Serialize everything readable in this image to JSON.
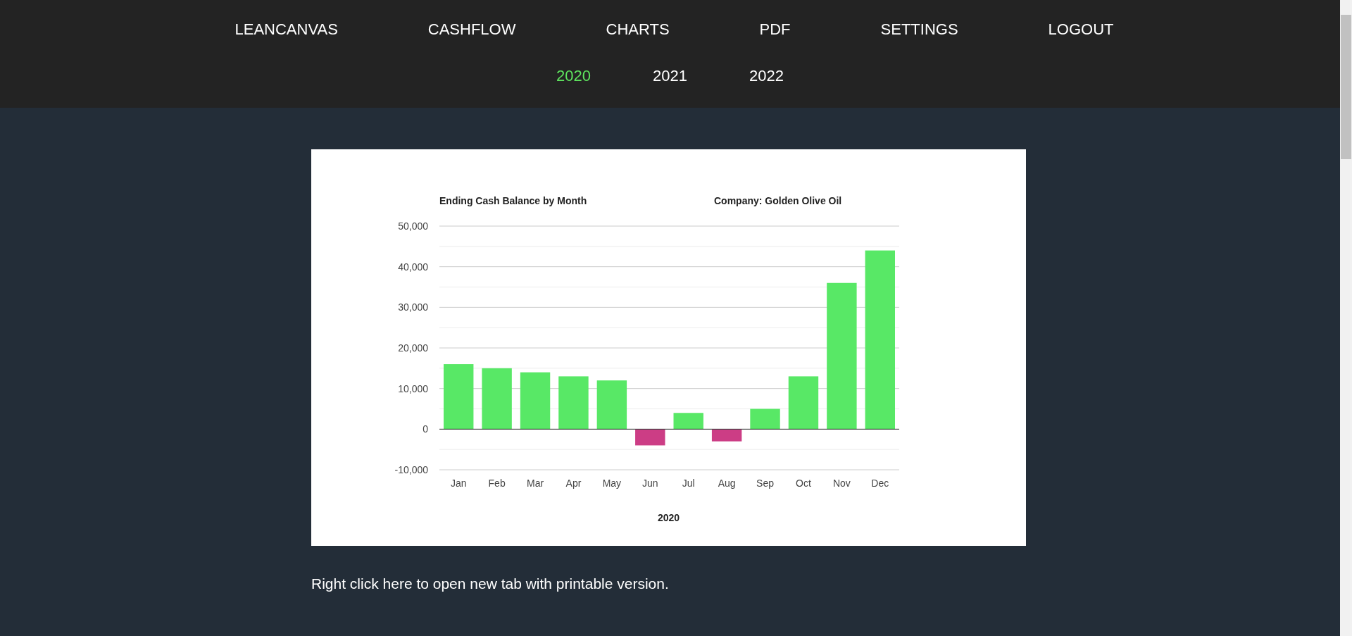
{
  "nav": {
    "items": [
      {
        "label": "LEANCANVAS"
      },
      {
        "label": "CASHFLOW"
      },
      {
        "label": "CHARTS"
      },
      {
        "label": "PDF"
      },
      {
        "label": "SETTINGS"
      },
      {
        "label": "LOGOUT"
      }
    ]
  },
  "years": [
    {
      "label": "2020",
      "selected": true
    },
    {
      "label": "2021",
      "selected": false
    },
    {
      "label": "2022",
      "selected": false
    }
  ],
  "chart": {
    "company": "Company: Golden Olive Oil",
    "chart_data": {
      "type": "bar",
      "title": "Ending Cash Balance by Month",
      "xlabel": "2020",
      "categories": [
        "Jan",
        "Feb",
        "Mar",
        "Apr",
        "May",
        "Jun",
        "Jul",
        "Aug",
        "Sep",
        "Oct",
        "Nov",
        "Dec"
      ],
      "series": [
        {
          "color": "#58e866",
          "values": [
            16000,
            15000,
            14000,
            13000,
            12000,
            null,
            4000,
            null,
            5000,
            13000,
            36000,
            44000
          ]
        },
        {
          "color": "#cc3d85",
          "values": [
            null,
            null,
            null,
            null,
            null,
            -4000,
            null,
            -3000,
            null,
            null,
            null,
            null
          ]
        }
      ],
      "stacked": true,
      "grid": true,
      "ylim": [
        -10000,
        50000
      ],
      "yticks": [
        {
          "value": -10000,
          "label": "-10,000"
        },
        {
          "value": 0,
          "label": "0"
        },
        {
          "value": 10000,
          "label": "10,000"
        },
        {
          "value": 20000,
          "label": "20,000"
        },
        {
          "value": 30000,
          "label": "30,000"
        },
        {
          "value": 40000,
          "label": "40,000"
        },
        {
          "value": 50000,
          "label": "50,000"
        }
      ]
    }
  },
  "print_link": "Right click here to open new tab with printable version."
}
